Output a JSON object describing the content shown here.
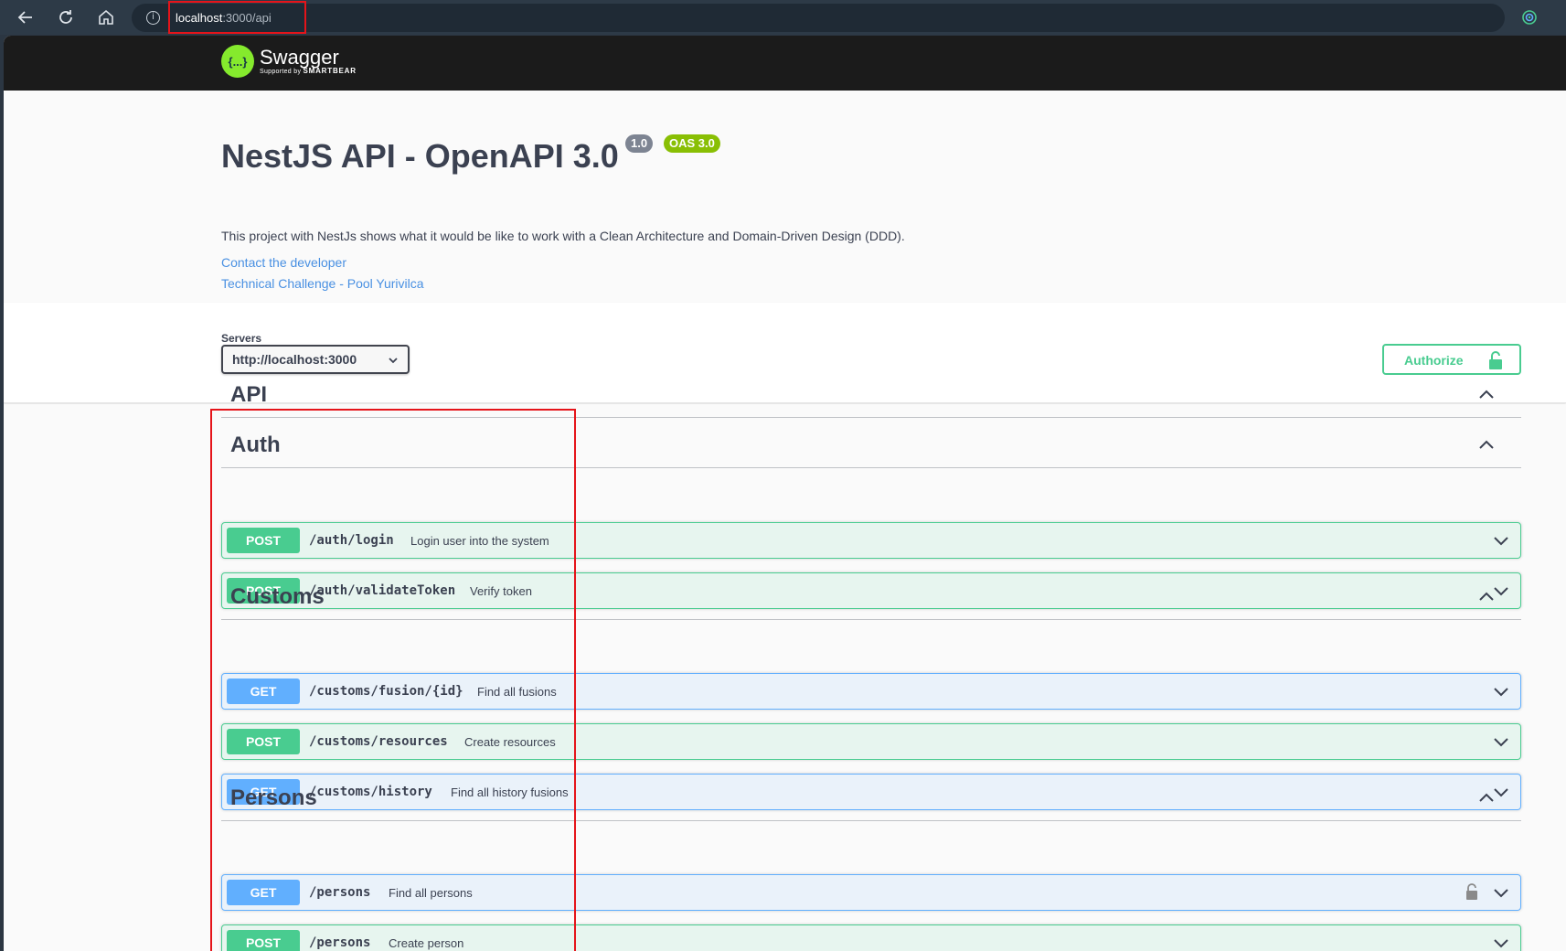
{
  "browser": {
    "url_host": "localhost",
    "url_rest": ":3000/api"
  },
  "header": {
    "logo_name": "Swagger",
    "logo_sub_prefix": "Supported by",
    "logo_sub_brand": "SMARTBEAR",
    "logo_glyph": "{...}"
  },
  "info": {
    "title": "NestJS API - OpenAPI 3.0",
    "version_badge": "1.0",
    "oas_badge": "OAS 3.0",
    "description": "This project with NestJs shows what it would be like to work with a Clean Architecture and Domain-Driven Design (DDD).",
    "contact_link": "Contact the developer",
    "challenge_link": "Technical Challenge - Pool Yurivilca"
  },
  "servers": {
    "label": "Servers",
    "selected": "http://localhost:3000",
    "authorize_label": "Authorize"
  },
  "tags": [
    {
      "name": "API"
    },
    {
      "name": "Auth"
    },
    {
      "name": "Customs"
    },
    {
      "name": "Persons"
    }
  ],
  "operations": [
    {
      "method": "POST",
      "path": "/auth/login",
      "summary": "Login user into the system"
    },
    {
      "method": "POST",
      "path": "/auth/validateToken",
      "summary": "Verify token"
    },
    {
      "method": "GET",
      "path": "/customs/fusion/{id}",
      "summary": "Find all fusions"
    },
    {
      "method": "POST",
      "path": "/customs/resources",
      "summary": "Create resources"
    },
    {
      "method": "GET",
      "path": "/customs/history",
      "summary": "Find all history fusions"
    },
    {
      "method": "GET",
      "path": "/persons",
      "summary": "Find all persons"
    },
    {
      "method": "POST",
      "path": "/persons",
      "summary": "Create person"
    }
  ],
  "icons": {
    "back": "back-arrow-icon",
    "reload": "reload-icon",
    "home": "home-icon",
    "info": "info-icon",
    "star": "star-icon",
    "extension": "extension-icon",
    "chevron": "chevron-icon",
    "lock": "lock-icon"
  },
  "colors": {
    "post": "#49cc90",
    "get": "#61affe",
    "swagger_green": "#85ea2d",
    "highlight": "#e5141a"
  }
}
